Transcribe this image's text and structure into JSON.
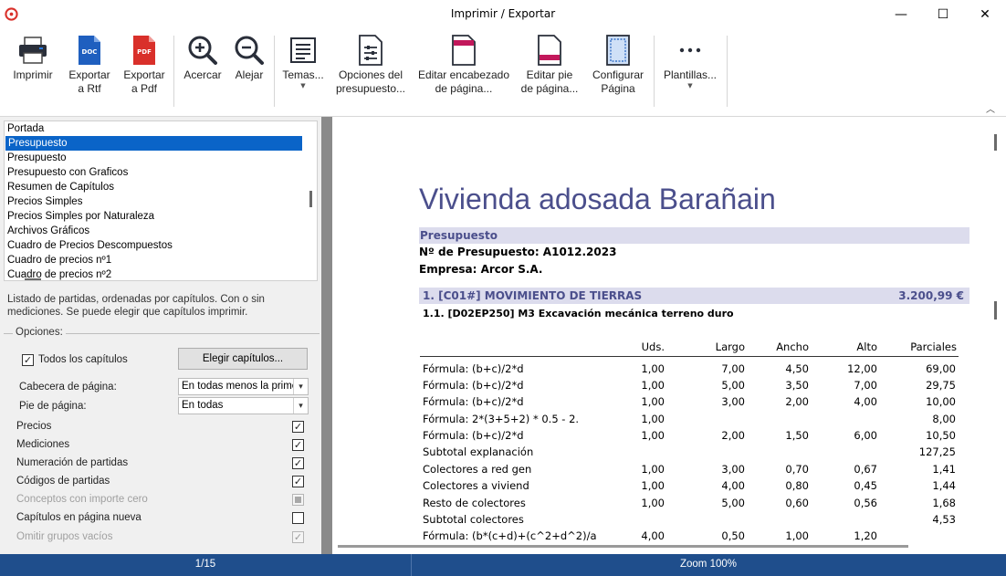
{
  "window": {
    "title": "Imprimir / Exportar",
    "minimize": "—",
    "maximize": "☐",
    "close": "✕"
  },
  "ribbon": {
    "buttons": [
      {
        "label": "Imprimir",
        "icon": "printer-icon"
      },
      {
        "label": "Exportar\na Rtf",
        "icon": "doc-file-icon",
        "badge": "DOC"
      },
      {
        "label": "Exportar\na Pdf",
        "icon": "pdf-file-icon",
        "badge": "PDF"
      },
      {
        "label": "Acercar",
        "icon": "zoom-in-icon"
      },
      {
        "label": "Alejar",
        "icon": "zoom-out-icon"
      },
      {
        "label": "Temas...",
        "icon": "themes-icon"
      },
      {
        "label": "Opciones del\npresupuesto...",
        "icon": "sliders-icon"
      },
      {
        "label": "Editar encabezado\nde página...",
        "icon": "page-header-icon"
      },
      {
        "label": "Editar pie\nde página...",
        "icon": "page-footer-icon"
      },
      {
        "label": "Configurar\nPágina",
        "icon": "page-setup-icon"
      },
      {
        "label": "Plantillas...",
        "icon": "more-icon"
      }
    ],
    "collapse": "︿",
    "accent": "#1e4e8c",
    "doc_color": "#1f5fbf",
    "pdf_color": "#d9302a"
  },
  "reports": {
    "items": [
      "Portada",
      "Presupuesto",
      "Presupuesto",
      "Presupuesto con Graficos",
      "Resumen de Capítulos",
      "Precios Simples",
      "Precios Simples por Naturaleza",
      "Archivos Gráficos",
      "Cuadro de Precios Descompuestos",
      "Cuadro de precios nº1",
      "Cuadro de precios nº2"
    ],
    "selected_index": 1,
    "description": "Listado de partidas, ordenadas por capítulos. Con o sin mediciones. Se puede elegir que capítulos imprimir."
  },
  "options": {
    "legend": "Opciones:",
    "todos_capitulos": {
      "label": "Todos los capítulos",
      "checked": true
    },
    "elegir_button": "Elegir capítulos...",
    "cabecera": {
      "label": "Cabecera de página:",
      "value": "En todas menos la primera"
    },
    "pie": {
      "label": "Pie de página:",
      "value": "En todas"
    },
    "checks": [
      {
        "label": "Precios",
        "checked": true,
        "disabled": false
      },
      {
        "label": "Mediciones",
        "checked": true,
        "disabled": false
      },
      {
        "label": "Numeración de partidas",
        "checked": true,
        "disabled": false
      },
      {
        "label": "Códigos de partidas",
        "checked": true,
        "disabled": false
      },
      {
        "label": "Conceptos con importe cero",
        "checked": "partial",
        "disabled": true
      },
      {
        "label": "Capítulos en página nueva",
        "checked": false,
        "disabled": false
      },
      {
        "label": "Omitir grupos vacíos",
        "checked": true,
        "disabled": true
      }
    ]
  },
  "document": {
    "title": "Vivienda adosada Barañain",
    "section": "Presupuesto",
    "numero": "Nº de Presupuesto: A1012.2023",
    "empresa": "Empresa: Arcor S.A.",
    "chapter": {
      "label": "1. [C01#] MOVIMIENTO DE TIERRAS",
      "amount": "3.200,99 €"
    },
    "item": "1.1. [D02EP250] M3 Excavación mecánica terreno duro",
    "columns": [
      "Uds.",
      "Largo",
      "Ancho",
      "Alto",
      "Parciales"
    ],
    "rows": [
      [
        "Fórmula: (b+c)/2*d",
        "1,00",
        "7,00",
        "4,50",
        "12,00",
        "69,00"
      ],
      [
        "Fórmula: (b+c)/2*d",
        "1,00",
        "5,00",
        "3,50",
        "7,00",
        "29,75"
      ],
      [
        "Fórmula: (b+c)/2*d",
        "1,00",
        "3,00",
        "2,00",
        "4,00",
        "10,00"
      ],
      [
        "Fórmula: 2*(3+5+2) * 0.5 - 2.",
        "1,00",
        "",
        "",
        "",
        "8,00"
      ],
      [
        "Fórmula: (b+c)/2*d",
        "1,00",
        "2,00",
        "1,50",
        "6,00",
        "10,50"
      ],
      [
        "Subtotal explanación",
        "",
        "",
        "",
        "",
        "127,25"
      ],
      [
        "Colectores a red gen",
        "1,00",
        "3,00",
        "0,70",
        "0,67",
        "1,41"
      ],
      [
        "Colectores a viviend",
        "1,00",
        "4,00",
        "0,80",
        "0,45",
        "1,44"
      ],
      [
        "Resto de colectores",
        "1,00",
        "5,00",
        "0,60",
        "0,56",
        "1,68"
      ],
      [
        "Subtotal colectores",
        "",
        "",
        "",
        "",
        "4,53"
      ],
      [
        "Fórmula: (b*(c+d)+(c^2+d^2)/a",
        "4,00",
        "0,50",
        "1,00",
        "1,20",
        ""
      ]
    ]
  },
  "status": {
    "page": "1/15",
    "zoom": "Zoom 100%"
  }
}
